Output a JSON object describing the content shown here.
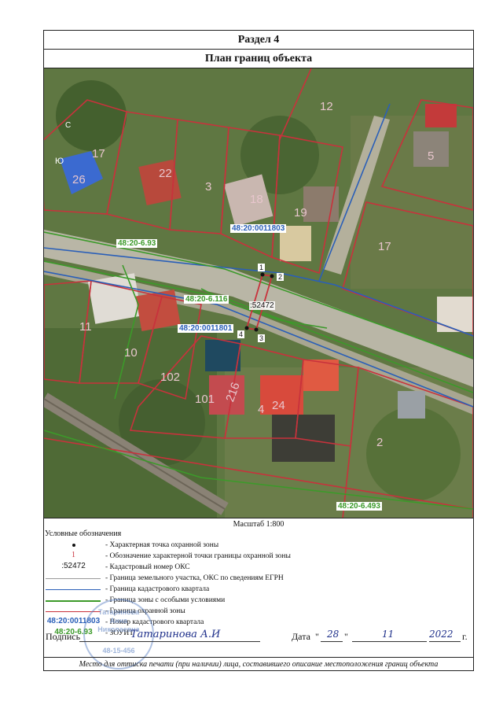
{
  "header": {
    "section": "Раздел 4",
    "title": "План границ объекта"
  },
  "map": {
    "north_label": "С",
    "south_label": "Ю",
    "parcel_numbers": [
      "12",
      "17",
      "22",
      "3",
      "18",
      "19",
      "5",
      "26",
      "17",
      "11",
      "10",
      "102",
      "101",
      "216",
      "24",
      "2",
      "4"
    ],
    "quarter_labels": [
      "48:20:0011803",
      "48:20:0011801"
    ],
    "zone_labels": [
      "48:20-6.93",
      "48:20-6.116",
      "48:20-6.493"
    ],
    "oks_label": ":52472",
    "point_labels": [
      "1",
      "2",
      "3",
      "4"
    ]
  },
  "scale": "Масштаб 1:800",
  "legend": {
    "title": "Условные обозначения",
    "items": [
      {
        "sample": "",
        "text": "- Характерная точка охранной зоны"
      },
      {
        "sample": "1",
        "text": "- Обозначение характерной точки границы охранной зоны"
      },
      {
        "sample": ":52472",
        "text": "- Кадастровый номер ОКС"
      },
      {
        "sample": "",
        "text": "- Граница земельного участка, ОКС по сведениям ЕГРН"
      },
      {
        "sample": "",
        "text": "- Граница кадастрового квартала"
      },
      {
        "sample": "",
        "text": "- Граница зоны с особыми условиями"
      },
      {
        "sample": "",
        "text": "- Граница охранной зоны"
      },
      {
        "sample": "48:20:0011803",
        "text": "- Номер кадастрового квартала"
      },
      {
        "sample": "48:20-6.93",
        "text": "- ЗОУИТ"
      }
    ]
  },
  "colors": {
    "quarter_blue": "#2a5fb8",
    "zone_green": "#3c9a2a",
    "parcel_red": "#c8323c",
    "point_red": "#c8323c"
  },
  "signature": {
    "label": "Подпись",
    "handwritten": "Татаринова А.И",
    "date_label": "Дата",
    "day": "28",
    "month": "11",
    "year": "2022",
    "year_suffix": "г."
  },
  "stamp": {
    "lines": [
      "Татаринова",
      "Анна",
      "Николаевна",
      "48-15-456"
    ]
  },
  "footer": "Место для оттиска печати (при наличии) лица, составившего описание местоположения границ объекта"
}
